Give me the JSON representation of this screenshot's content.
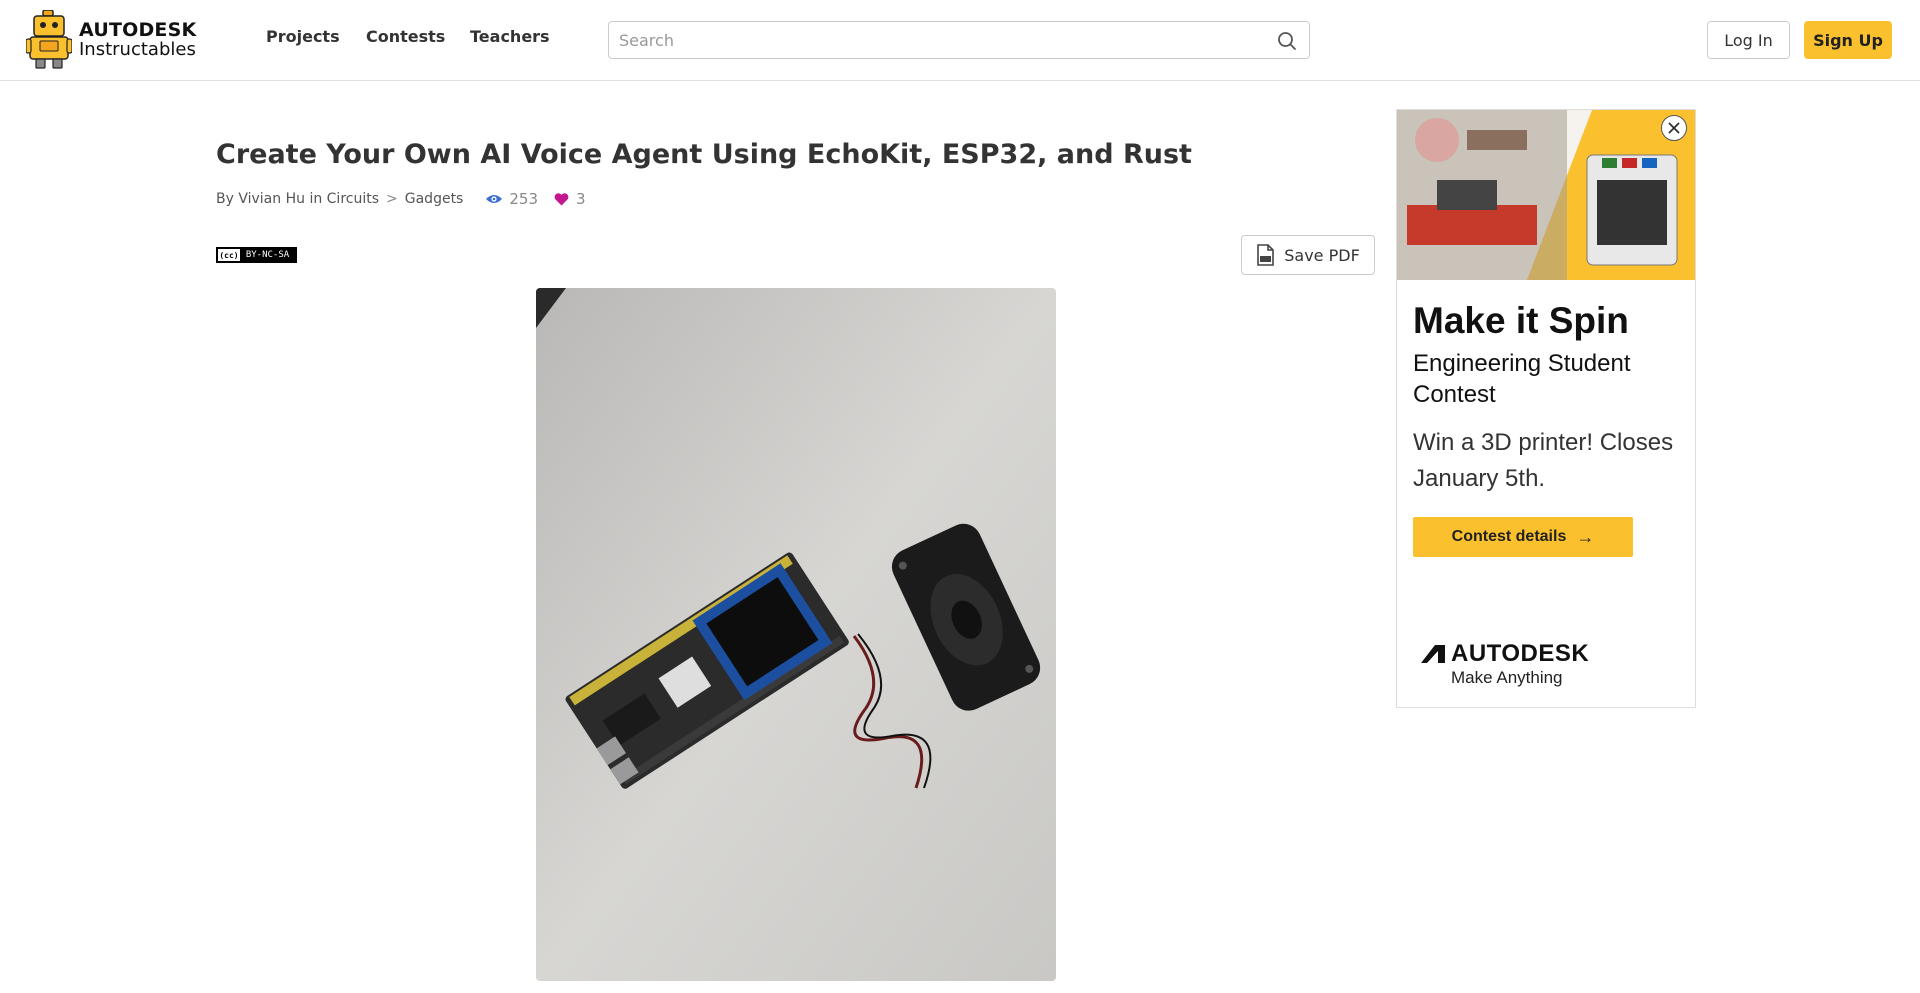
{
  "header": {
    "brand_top": "AUTODESK",
    "brand_bottom": "Instructables",
    "nav": [
      "Projects",
      "Contests",
      "Teachers"
    ],
    "search_placeholder": "Search",
    "login_label": "Log In",
    "signup_label": "Sign Up"
  },
  "article": {
    "title": "Create Your Own AI Voice Agent Using EchoKit, ESP32, and Rust",
    "by_label": "By",
    "author": "Vivian Hu",
    "in_label": "in",
    "category": "Circuits",
    "breadcrumb_sep": ">",
    "subcategory": "Gadgets",
    "views": "253",
    "favorites": "3",
    "license": "BY-NC-SA",
    "save_pdf_label": "Save PDF"
  },
  "ad": {
    "headline": "Make it Spin",
    "subheadline": "Engineering Student Contest",
    "body": "Win a 3D printer! Closes January 5th.",
    "cta_label": "Contest details",
    "brand": "AUTODESK",
    "tagline": "Make Anything"
  },
  "colors": {
    "accent": "#fbc02d",
    "view_icon": "#3b6fd6",
    "heart_icon": "#c2178f"
  }
}
